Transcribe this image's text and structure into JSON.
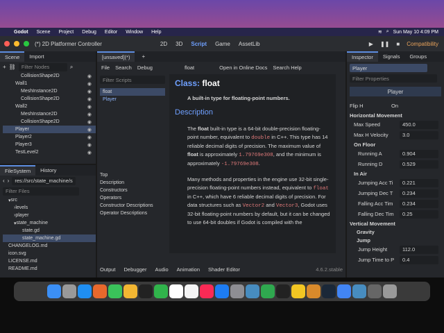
{
  "os": {
    "app": "Godot",
    "menus": [
      "Scene",
      "Project",
      "Debug",
      "Editor",
      "Window",
      "Help"
    ],
    "clock": "Sun May 10  4:09 PM"
  },
  "window": {
    "title": "(*) 2D Platformer Controller",
    "modes": [
      "2D",
      "3D",
      "Script",
      "Game",
      "AssetLib"
    ],
    "active_mode": "Script",
    "renderer": "Compatibility"
  },
  "scene": {
    "tabs": [
      "Scene",
      "Import"
    ],
    "filter": "Filter Nodes",
    "nodes": [
      "CollisionShape2D",
      "Wall1",
      "MeshInstance2D",
      "CollisionShape2D",
      "Wall2",
      "MeshInstance2D",
      "CollisionShape2D",
      "Player",
      "Player2",
      "Player3",
      "TestLevel2"
    ]
  },
  "files": {
    "tabs": [
      "FileSystem",
      "History"
    ],
    "path": "res://src/state_machine/s",
    "filter": "Filter Files",
    "items": [
      "src",
      "levels",
      "player",
      "state_machine",
      "state.gd",
      "state_machine.gd",
      "CHANGELOG.md",
      "icon.svg",
      "LICENSE.md",
      "README.md"
    ]
  },
  "script": {
    "tab": "[unsaved](*)",
    "menus": [
      "File",
      "Search",
      "Debug"
    ],
    "filter": "Filter Scripts",
    "scripts": [
      "float",
      "Player"
    ],
    "outline": [
      "Top",
      "Description",
      "Constructors",
      "Operators",
      "Constructor Descriptions",
      "Operator Descriptions"
    ],
    "breadcrumb": "float",
    "online_docs": "Open in Online Docs",
    "search_help": "Search Help"
  },
  "doc": {
    "class_label": "Class:",
    "class_name": "float",
    "brief": "A built-in type for floating-point numbers.",
    "heading": "Description",
    "p1a": "The ",
    "p1b": "float",
    "p1c": " built-in type is a 64-bit double-precision floating-point number, equivalent to ",
    "p1d": "double",
    "p1e": " in C++. This type has 14 reliable decimal digits of precision. The maximum value of ",
    "p1f": "float",
    "p1g": " is approximately ",
    "p1h": "1.79769e308",
    "p1i": ", and the minimum is approximately ",
    "p1j": "-1.79769e308",
    "p1k": ".",
    "p2a": "Many methods and properties in the engine use 32-bit single-precision floating-point numbers instead, equivalent to ",
    "p2b": "float",
    "p2c": " in C++, which have 6 reliable decimal digits of precision. For data structures such as ",
    "p2d": "Vector2",
    "p2e": " and ",
    "p2f": "Vector3",
    "p2g": ", Godot uses 32-bit floating-point numbers by default, but it can be changed to use 64-bit doubles if Godot is compiled with the"
  },
  "bottom": {
    "tabs": [
      "Output",
      "Debugger",
      "Audio",
      "Animation",
      "Shader Editor"
    ],
    "version": "4.6.2.stable"
  },
  "inspector": {
    "tabs": [
      "Inspector",
      "Signals",
      "Groups"
    ],
    "object": "Player",
    "filter": "Filter Properties",
    "header": "Player",
    "flip_h": {
      "label": "Flip H",
      "value": "On"
    },
    "sections": {
      "horizontal": "Horizontal Movement",
      "on_floor": "On Floor",
      "in_air": "In Air",
      "vertical": "Vertical Movement",
      "gravity": "Gravity",
      "jump": "Jump"
    },
    "props": [
      {
        "label": "Max Speed",
        "value": "450.0"
      },
      {
        "label": "Max H Velocity",
        "value": "3.0"
      },
      {
        "label": "Running A",
        "value": "0.904"
      },
      {
        "label": "Running D",
        "value": "0.529"
      },
      {
        "label": "Jumping Acc Ti",
        "value": "0.221"
      },
      {
        "label": "Jumping Dec T",
        "value": "0.234"
      },
      {
        "label": "Falling Acc Tim",
        "value": "0.234"
      },
      {
        "label": "Falling Dec Tim",
        "value": "0.25"
      },
      {
        "label": "Jump Height",
        "value": "112.0"
      },
      {
        "label": "Jump Time to P",
        "value": "0.4"
      }
    ]
  }
}
